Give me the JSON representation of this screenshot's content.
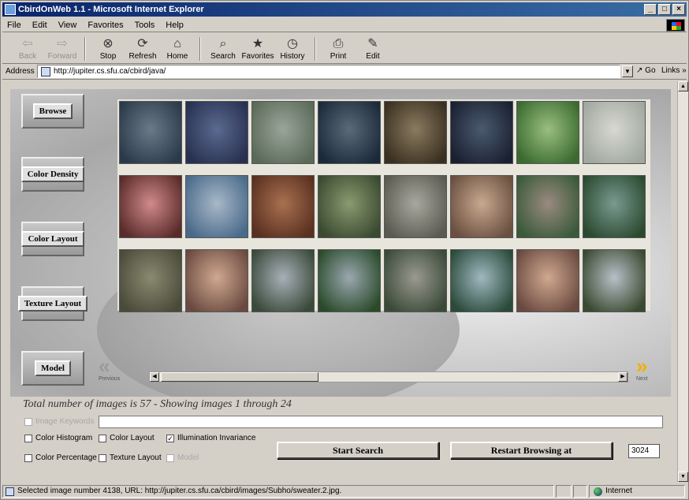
{
  "window": {
    "title": "CbirdOnWeb 1.1 - Microsoft Internet Explorer"
  },
  "menu": [
    "File",
    "Edit",
    "View",
    "Favorites",
    "Tools",
    "Help"
  ],
  "toolbar": [
    {
      "label": "Back",
      "icon": "back-arrow-icon",
      "glyph": "⇦",
      "enabled": false
    },
    {
      "label": "Forward",
      "icon": "forward-arrow-icon",
      "glyph": "⇨",
      "enabled": false
    },
    {
      "label": "Stop",
      "icon": "stop-icon",
      "glyph": "⊗",
      "enabled": true
    },
    {
      "label": "Refresh",
      "icon": "refresh-icon",
      "glyph": "⟳",
      "enabled": true
    },
    {
      "label": "Home",
      "icon": "home-icon",
      "glyph": "⌂",
      "enabled": true
    },
    {
      "label": "Search",
      "icon": "search-icon",
      "glyph": "⌕",
      "enabled": true
    },
    {
      "label": "Favorites",
      "icon": "favorites-icon",
      "glyph": "★",
      "enabled": true
    },
    {
      "label": "History",
      "icon": "history-icon",
      "glyph": "◷",
      "enabled": true
    },
    {
      "label": "Print",
      "icon": "print-icon",
      "glyph": "⎙",
      "enabled": true
    },
    {
      "label": "Edit",
      "icon": "edit-icon",
      "glyph": "✎",
      "enabled": true
    }
  ],
  "address": {
    "label": "Address",
    "url": "http://jupiter.cs.sfu.ca/cbird/java/",
    "go": "Go",
    "links": "Links »"
  },
  "nav_buttons": [
    "Browse",
    "Color Density",
    "Color Layout",
    "Texture Layout",
    "Model"
  ],
  "thumbnails": [
    [
      "#2a3a4a",
      "#6a7a88"
    ],
    [
      "#283050",
      "#5a6a90"
    ],
    [
      "#5a6a58",
      "#9aa59a"
    ],
    [
      "#1a2a3a",
      "#5a6a78"
    ],
    [
      "#3a3020",
      "#8a7a60"
    ],
    [
      "#1a2030",
      "#4a5a70"
    ],
    [
      "#3a6a30",
      "#9abf80"
    ],
    [
      "#a0a8a0",
      "#d8d8d0"
    ],
    [
      "#5a2a2a",
      "#d08a8a"
    ],
    [
      "#4a6a8a",
      "#a8b8c8"
    ],
    [
      "#5a3020",
      "#a87050"
    ],
    [
      "#3a4a30",
      "#8a9a70"
    ],
    [
      "#5a5a50",
      "#a8a8a0"
    ],
    [
      "#6a5040",
      "#c8a890"
    ],
    [
      "#3a5a3a",
      "#9a8a80"
    ],
    [
      "#2a4a30",
      "#7a9a90"
    ],
    [
      "#4a4a3a",
      "#8a8a70"
    ],
    [
      "#6a4a40",
      "#d0a890"
    ],
    [
      "#3a4a3a",
      "#a8b0b8"
    ],
    [
      "#2a4a2a",
      "#9aa8b0"
    ],
    [
      "#3a4a38",
      "#9a9a90"
    ],
    [
      "#2a4a3a",
      "#a0b8c0"
    ],
    [
      "#6a4a40",
      "#d0a890"
    ],
    [
      "#3a4a30",
      "#b8c0c8"
    ]
  ],
  "prev_label": "Previous",
  "next_label": "Next",
  "total_text": "Total number of images is 57 - Showing images 1 through 24",
  "checkboxes": {
    "image_keywords": {
      "label": "Image Keywords",
      "checked": false,
      "enabled": false
    },
    "color_histogram": {
      "label": "Color Histogram",
      "checked": false,
      "enabled": true
    },
    "color_layout": {
      "label": "Color Layout",
      "checked": false,
      "enabled": true
    },
    "illumination_invariance": {
      "label": "Illumination Invariance",
      "checked": true,
      "enabled": true
    },
    "color_percentage": {
      "label": "Color Percentage",
      "checked": false,
      "enabled": true
    },
    "texture_layout": {
      "label": "Texture Layout",
      "checked": false,
      "enabled": true
    },
    "model": {
      "label": "Model",
      "checked": false,
      "enabled": false
    }
  },
  "keywords_value": "",
  "start_search": "Start Search",
  "restart_browsing": "Restart Browsing at",
  "restart_value": "3024",
  "status": {
    "text": "Selected image number 4138, URL: http://jupiter.cs.sfu.ca/cbird/images/Subho/sweater.2.jpg.",
    "zone": "Internet"
  }
}
